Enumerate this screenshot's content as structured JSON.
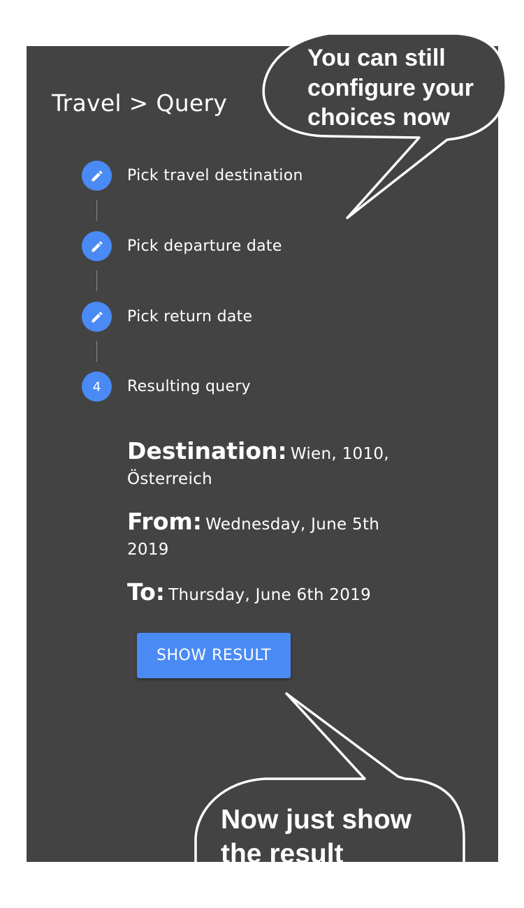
{
  "header": {
    "breadcrumb": "Travel > Query"
  },
  "steps": [
    {
      "label": "Pick travel destination",
      "icon": "pencil-icon"
    },
    {
      "label": "Pick departure date",
      "icon": "pencil-icon"
    },
    {
      "label": "Pick return date",
      "icon": "pencil-icon"
    },
    {
      "label": "Resulting query",
      "number": "4"
    }
  ],
  "summary": {
    "destination_key": "Destination:",
    "destination_val": "Wien, 1010, Österreich",
    "from_key": "From:",
    "from_val": "Wednesday, June 5th 2019",
    "to_key": "To:",
    "to_val": "Thursday, June 6th 2019"
  },
  "actions": {
    "show_result": "SHOW RESULT"
  },
  "annotations": {
    "top_bubble": "You can still configure your choices now",
    "bottom_bubble": "Now just show the result"
  },
  "colors": {
    "panel": "#434343",
    "accent": "#4a8af4"
  }
}
